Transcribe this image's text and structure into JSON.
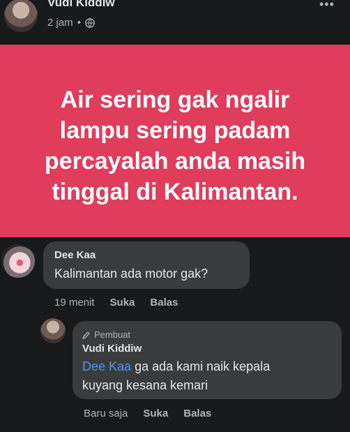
{
  "post": {
    "author": "Vudi Kiddiw",
    "time": "2 jam",
    "separator": "•",
    "privacy_icon": "globe-icon",
    "more_label": "•••",
    "banner_lines": [
      "Air sering gak ngalir",
      "lampu sering padam",
      "percayalah anda masih",
      "tinggal di Kalimantan."
    ],
    "banner_color": "#e03c5c"
  },
  "comments": [
    {
      "author": "Dee Kaa",
      "text": "Kalimantan ada motor gak?",
      "time": "19 menit",
      "like": "Suka",
      "reply": "Balas"
    }
  ],
  "reply": {
    "badge": "Pembuat",
    "author": "Vudi Kiddiw",
    "mention": "Dee Kaa",
    "text_line1": "ga ada kami naik kepala",
    "text_line2": "kuyang kesana kemari",
    "time": "Baru saja",
    "like": "Suka",
    "reply": "Balas"
  }
}
